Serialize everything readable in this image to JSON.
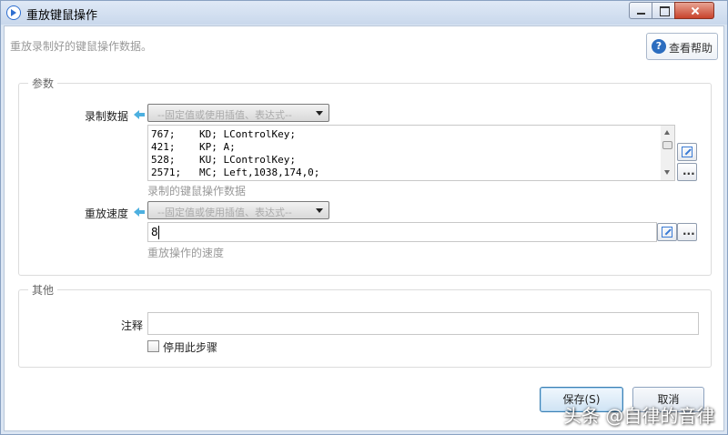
{
  "window": {
    "title": "重放键鼠操作"
  },
  "description": "重放录制好的键鼠操作数据。",
  "help_button": {
    "icon_text": "?",
    "label": "查看帮助"
  },
  "params": {
    "group_title": "参数",
    "record_data": {
      "label": "录制数据",
      "dropdown": "--固定值或使用插值、表达式--",
      "lines": [
        "767;    KD; LControlKey;",
        "421;    KP; A;",
        "528;    KU; LControlKey;",
        "2571;   MC; Left,1038,174,0;"
      ],
      "hint": "录制的键鼠操作数据"
    },
    "speed": {
      "label": "重放速度",
      "dropdown": "--固定值或使用插值、表达式--",
      "value": "8",
      "hint": "重放操作的速度"
    },
    "side_button_label": "..."
  },
  "other": {
    "group_title": "其他",
    "note_label": "注释",
    "note_value": "",
    "disable_label": "停用此步骤",
    "disable_checked": false
  },
  "buttons": {
    "save": "保存(S)",
    "cancel": "取消"
  },
  "watermark": "头条 @自律的音律",
  "colors": {
    "accent": "#4db0e0",
    "help_icon": "#2c6dbf",
    "close_button": "#c8432c"
  }
}
